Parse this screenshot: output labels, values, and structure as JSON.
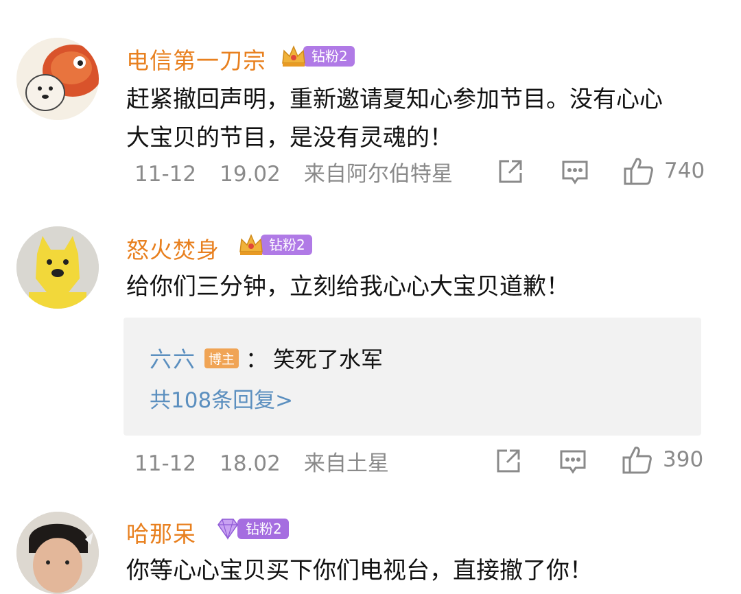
{
  "comments": [
    {
      "username": "电信第一刀宗",
      "badge": "钻粉2",
      "text_lines": [
        "赶紧撤回声明，重新邀请夏知心参加节目。没有心心",
        "大宝贝的节目，是没有灵魂的！"
      ],
      "date": "11-12",
      "time": "19.02",
      "location": "来自阿尔伯特星",
      "likes": "740"
    },
    {
      "username": "怒火焚身",
      "badge": "钻粉2",
      "text_lines": [
        "给你们三分钟，立刻给我心心大宝贝道歉！"
      ],
      "reply": {
        "user": "六六",
        "role_badge": "博主",
        "colon": "：",
        "text": "笑死了水军",
        "more": "共108条回复>"
      },
      "date": "11-12",
      "time": "18.02",
      "location": "来自土星",
      "likes": "390"
    },
    {
      "username": "哈那呆",
      "badge": "钻粉2",
      "text_lines": [
        "你等心心宝贝买下你们电视台，直接撤了你！"
      ]
    }
  ],
  "icons": {
    "share": "share-icon",
    "comment": "comment-icon",
    "like": "thumbs-up-icon",
    "crown": "crown-icon",
    "gem": "diamond-icon"
  },
  "colors": {
    "username": "#e8801f",
    "badge": "#b07ae6",
    "reply_user": "#5b8fbf",
    "meta": "#8a8a8a",
    "reply_bg": "#f2f2f2"
  }
}
